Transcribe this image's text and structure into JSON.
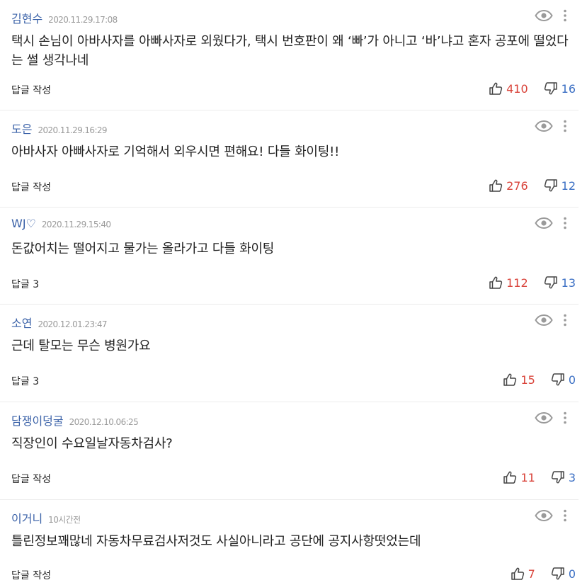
{
  "comments": [
    {
      "author": "김현수",
      "date": "2020.11.29.17:08",
      "text": "택시 손님이 아바사자를 아빠사자로 외웠다가, 택시 번호판이 왜 ‘빠’가 아니고 ‘바’냐고 혼자 공포에 떨었다는 썰 생각나네",
      "reply": "답글 작성",
      "likes": "410",
      "dislikes": "16"
    },
    {
      "author": "도은",
      "date": "2020.11.29.16:29",
      "text": "아바사자 아빠사자로 기억해서 외우시면 편해요! 다들 화이팅!!",
      "reply": "답글 작성",
      "likes": "276",
      "dislikes": "12"
    },
    {
      "author": "WJ♡",
      "date": "2020.11.29.15:40",
      "text": "돈값어치는 떨어지고 물가는 올라가고 다들 화이팅",
      "reply": "답글 3",
      "likes": "112",
      "dislikes": "13"
    },
    {
      "author": "소연",
      "date": "2020.12.01.23:47",
      "text": "근데 탈모는 무슨 병원가요",
      "reply": "답글 3",
      "likes": "15",
      "dislikes": "0"
    },
    {
      "author": "담쟁이덩굴",
      "date": "2020.12.10.06:25",
      "text": "직장인이 수요일날자동차검사?",
      "reply": "답글 작성",
      "likes": "11",
      "dislikes": "3"
    },
    {
      "author": "이거니",
      "date": "10시간전",
      "text": "틀린정보꽤많네 자동차무료검사저것도 사실아니라고 공단에 공지사항떳었는데",
      "reply": "답글 작성",
      "likes": "7",
      "dislikes": "0"
    }
  ],
  "icons": {
    "view": "eye-icon",
    "more": "more-vertical-icon",
    "like": "thumbs-up-icon",
    "dislike": "thumbs-down-icon"
  },
  "colors": {
    "author": "#3b62a8",
    "date": "#9a9a9a",
    "like": "#d9433a",
    "dislike": "#3b6fc4",
    "divider": "#ececec"
  }
}
